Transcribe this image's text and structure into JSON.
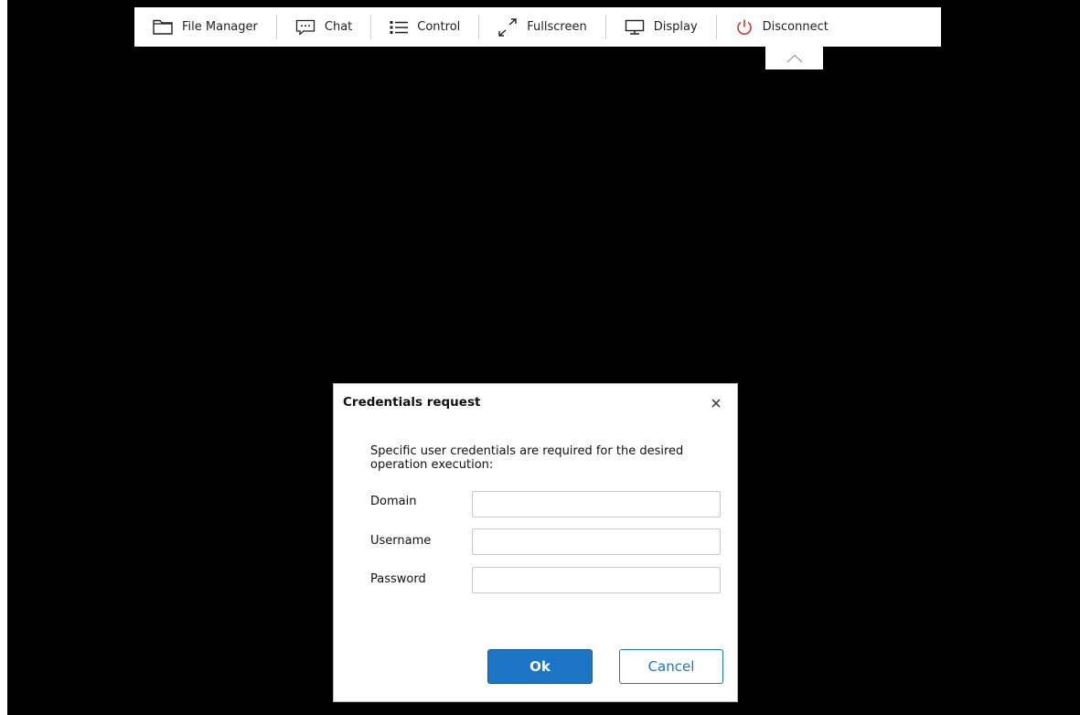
{
  "toolbar": {
    "items": [
      {
        "label": "File Manager",
        "icon": "folder-icon"
      },
      {
        "label": "Chat",
        "icon": "chat-icon"
      },
      {
        "label": "Control",
        "icon": "list-icon"
      },
      {
        "label": "Fullscreen",
        "icon": "fullscreen-icon"
      },
      {
        "label": "Display",
        "icon": "monitor-icon"
      },
      {
        "label": "Disconnect",
        "icon": "power-icon"
      }
    ],
    "collapse_icon": "chevron-up-icon"
  },
  "dialog": {
    "title": "Credentials request",
    "message": "Specific user credentials are required for the desired operation execution:",
    "fields": [
      {
        "label": "Domain",
        "value": ""
      },
      {
        "label": "Username",
        "value": ""
      },
      {
        "label": "Password",
        "value": ""
      }
    ],
    "ok_label": "Ok",
    "cancel_label": "Cancel"
  },
  "colors": {
    "screen_background": "#000000",
    "accent": "#1c74c5",
    "disconnect_icon": "#d9312b"
  }
}
